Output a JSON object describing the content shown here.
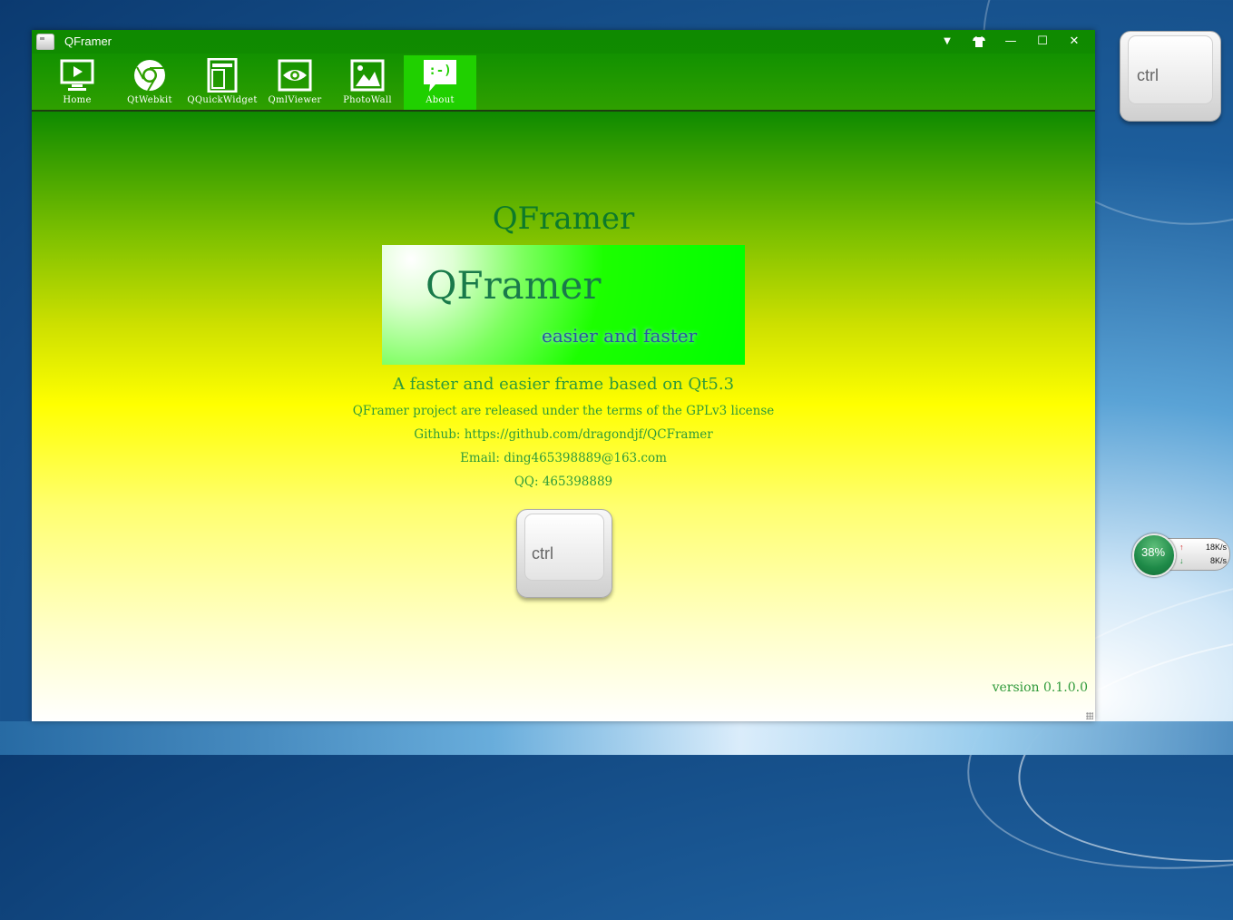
{
  "window": {
    "title": "QFramer",
    "controls": {
      "dropdown_icon": "▼",
      "skin_icon": "shirt-icon",
      "minimize_icon": "—",
      "maximize_icon": "☐",
      "close_icon": "✕"
    }
  },
  "toolbar": {
    "items": [
      {
        "label": "Home",
        "icon": "monitor-play-icon"
      },
      {
        "label": "QtWebkit",
        "icon": "chrome-icon"
      },
      {
        "label": "QQuickWidget",
        "icon": "layout-icon"
      },
      {
        "label": "QmlViewer",
        "icon": "eye-icon"
      },
      {
        "label": "PhotoWall",
        "icon": "image-icon"
      },
      {
        "label": "About",
        "icon": "smiley-chat-icon",
        "active": true,
        "glyph": ":-)"
      }
    ]
  },
  "about": {
    "heading": "QFramer",
    "banner_title": "QFramer",
    "banner_tagline": "easier and faster",
    "line1": "A faster and easier frame based on Qt5.3",
    "line2": "QFramer project are released under the terms of the GPLv3 license",
    "line3": "Github: https://github.com/dragondjf/QCFramer",
    "line4": "Email: ding465398889@163.com",
    "line5": "QQ: 465398889",
    "key_label": "ctrl",
    "version": "version 0.1.0.0"
  },
  "desktop": {
    "ctrl_key_label": "ctrl",
    "net_widget": {
      "cpu_percent": "38%",
      "up_icon": "↑",
      "up_rate": "18K/s",
      "down_icon": "↓",
      "down_rate": "8K/s"
    }
  },
  "colors": {
    "title_green": "#0f8a00",
    "active_tab": "#20d000",
    "text_green": "#2f9a3a"
  }
}
